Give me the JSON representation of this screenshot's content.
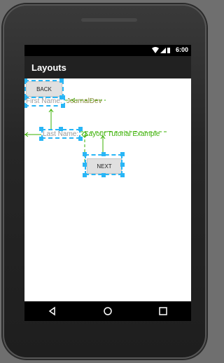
{
  "status_bar": {
    "time": "6:00"
  },
  "app_bar": {
    "title": "Layouts"
  },
  "content": {
    "back_button": "BACK",
    "next_button": "NEXT",
    "first_name_label": "First Name:",
    "first_name_value": "JournalDev",
    "last_name_label": "Last Name:",
    "last_name_value": "Layout Tutorial Example"
  },
  "colors": {
    "selection": "#29b6f6",
    "constraint": "#38b000"
  },
  "icons": [
    "wifi-icon",
    "cell-signal-icon",
    "battery-icon",
    "back-icon",
    "home-icon",
    "recents-icon"
  ]
}
